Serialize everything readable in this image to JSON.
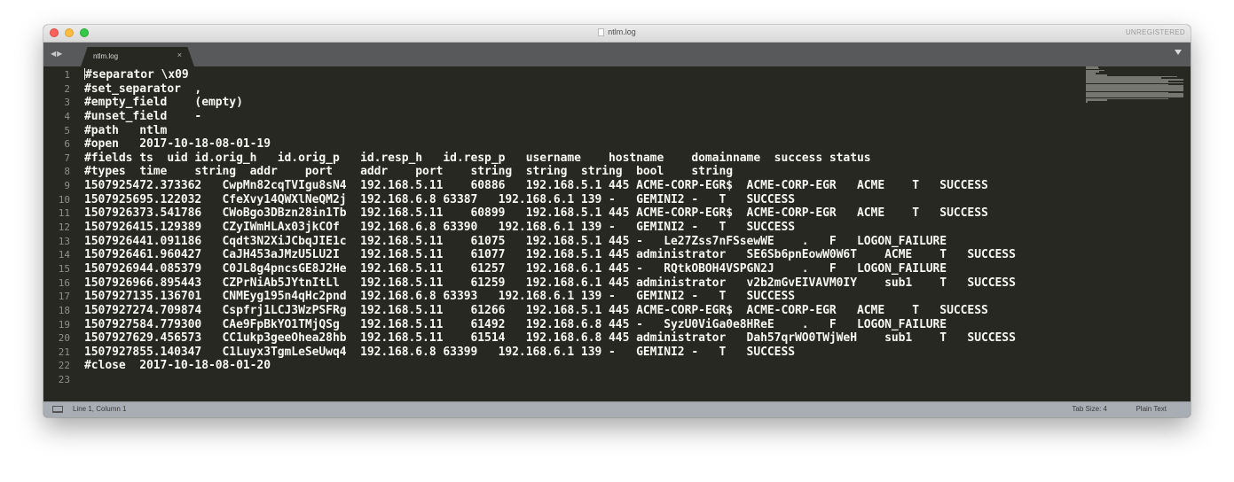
{
  "window": {
    "title": "ntlm.log",
    "title_icon": "document-icon",
    "registration": "UNREGISTERED"
  },
  "tabbar": {
    "nav_icon": "left-right-arrows-icon",
    "tabs": [
      {
        "label": "ntlm.log",
        "close": "×"
      }
    ],
    "dropdown_icon": "triangle-down-icon"
  },
  "editor": {
    "line_numbers": [
      "1",
      "2",
      "3",
      "4",
      "5",
      "6",
      "7",
      "8",
      "9",
      "10",
      "11",
      "12",
      "13",
      "14",
      "15",
      "16",
      "17",
      "18",
      "19",
      "20",
      "21",
      "22",
      "23"
    ],
    "lines": [
      "#separator \\x09",
      "#set_separator  ,",
      "#empty_field    (empty)",
      "#unset_field    -",
      "#path   ntlm",
      "#open   2017-10-18-08-01-19",
      "#fields ts  uid id.orig_h   id.orig_p   id.resp_h   id.resp_p   username    hostname    domainname  success status",
      "#types  time    string  addr    port    addr    port    string  string  string  bool    string",
      "1507925472.373362   CwpMn82cqTVIgu8sN4  192.168.5.11    60886   192.168.5.1 445 ACME-CORP-EGR$  ACME-CORP-EGR   ACME    T   SUCCESS",
      "1507925695.122032   CfeXvy14QWXlNeQM2j  192.168.6.8 63387   192.168.6.1 139 -   GEMINI2 -   T   SUCCESS",
      "1507926373.541786   CWoBgo3DBzn28in1Tb  192.168.5.11    60899   192.168.5.1 445 ACME-CORP-EGR$  ACME-CORP-EGR   ACME    T   SUCCESS",
      "1507926415.129389   CZyIWmHLAx03jkCOf   192.168.6.8 63390   192.168.6.1 139 -   GEMINI2 -   T   SUCCESS",
      "1507926441.091186   Cqdt3N2XiJCbqJIE1c  192.168.5.11    61075   192.168.5.1 445 -   Le27Zss7nFSsewWE    .   F   LOGON_FAILURE",
      "1507926461.960427   CaJH453aJMzU5LU2I   192.168.5.11    61077   192.168.5.1 445 administrator   SE6Sb6pnEowW0W6T    ACME    T   SUCCESS",
      "1507926944.085379   C0JL8g4pncsGE8J2He  192.168.5.11    61257   192.168.6.1 445 -   RQtkOBOH4VSPGN2J    .   F   LOGON_FAILURE",
      "1507926966.895443   CZPrNiAb5JYtnItLl   192.168.5.11    61259   192.168.6.1 445 administrator   v2b2mGvEIVAVM0IY    sub1    T   SUCCESS",
      "1507927135.136701   CNMEyg195n4qHc2pnd  192.168.6.8 63393   192.168.6.1 139 -   GEMINI2 -   T   SUCCESS",
      "1507927274.709874   Cspfrj1LCJ3WzPSFRg  192.168.5.11    61266   192.168.5.1 445 ACME-CORP-EGR$  ACME-CORP-EGR   ACME    T   SUCCESS",
      "1507927584.779300   CAe9FpBkYO1TMjQSg   192.168.5.11    61492   192.168.6.8 445 -   SyzU0ViGa0e8HReE    .   F   LOGON_FAILURE",
      "1507927629.456573   CC1ukp3geeOhea28hb  192.168.5.11    61514   192.168.6.8 445 administrator   Dah57qrWO0TWjWeH    sub1    T   SUCCESS",
      "1507927855.140347   C1Luyx3TgmLeSeUwq4  192.168.6.8 63399   192.168.6.1 139 -   GEMINI2 -   T   SUCCESS",
      "#close  2017-10-18-08-01-20",
      ""
    ]
  },
  "statusbar": {
    "panel_icon": "panel-toggle-icon",
    "position": "Line 1, Column 1",
    "tab_size": "Tab Size: 4",
    "syntax": "Plain Text"
  }
}
